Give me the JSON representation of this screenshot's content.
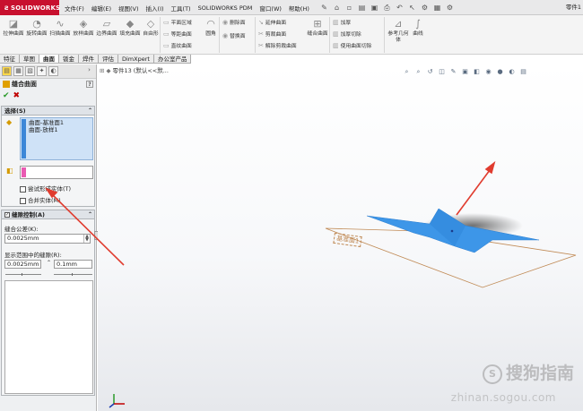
{
  "titlebar": {
    "logo": "SOLIDWORKS",
    "menus": [
      "文件(F)",
      "编辑(E)",
      "视图(V)",
      "插入(I)",
      "工具(T)",
      "SOLIDWORKS PDM",
      "窗口(W)",
      "帮助(H)"
    ],
    "doc_name": "零件1"
  },
  "ribbon": {
    "big_buttons": [
      {
        "label": "拉伸曲面",
        "icon": "extruded-surface-icon"
      },
      {
        "label": "旋转曲面",
        "icon": "revolved-surface-icon"
      },
      {
        "label": "扫描曲面",
        "icon": "swept-surface-icon"
      },
      {
        "label": "放样曲面",
        "icon": "lofted-surface-icon"
      },
      {
        "label": "边界曲面",
        "icon": "boundary-surface-icon"
      },
      {
        "label": "填充曲面",
        "icon": "filled-surface-icon"
      },
      {
        "label": "自由形",
        "icon": "freeform-icon"
      }
    ],
    "small_col1": [
      "平面区域",
      "等距曲面",
      "直纹曲面"
    ],
    "round_label": "圆角",
    "small_col2": [
      "删除面",
      "替换面"
    ],
    "small_col3": [
      "延伸曲面",
      "剪裁曲面",
      "解除剪裁曲面"
    ],
    "knit_label": "缝合曲面",
    "small_col4": [
      "加厚",
      "加厚切除",
      "使用曲面切除"
    ],
    "ref_label": "参考几何体",
    "curves_label": "曲线"
  },
  "tabs": [
    "特征",
    "草图",
    "曲面",
    "钣金",
    "焊件",
    "评估",
    "DimXpert",
    "办公室产品"
  ],
  "active_tab": "曲面",
  "panel": {
    "title": "缝合曲面",
    "selection_header": "选择(S)",
    "selections": [
      "曲面-基准面1",
      "曲面-放样1"
    ],
    "try_solid": "尝试形成实体(T)",
    "merge_entities": "合并实体(M)",
    "gap_header": "缝隙控制(A)",
    "knit_tol_label": "缝合公差(K):",
    "knit_tol_value": "0.0025mm",
    "range_label": "显示范围中的缝隙(R):",
    "range_min": "0.0025mm",
    "range_max": "0.1mm"
  },
  "viewport": {
    "tree_label": "零件13 (默认<<默...",
    "plane_label": "基准面1",
    "watermark_text": "搜狗指南",
    "watermark_url": "zhinan.sogou.com"
  },
  "colors": {
    "brand": "#c8102e",
    "surface_blue": "#3d96e8",
    "selection_blue": "#cfe2f7",
    "arrow_red": "#e03c2f"
  }
}
